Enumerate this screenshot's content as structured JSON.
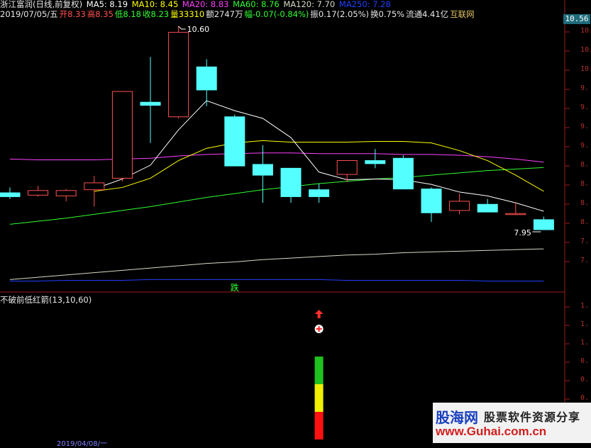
{
  "header": {
    "stock_name": "浙江富润(日线,前复权)",
    "ma5": "MA5: 8.19",
    "ma10": "MA10: 8.45",
    "ma20": "MA20: 8.83",
    "ma60": "MA60: 8.76",
    "ma120": "MA120: 7.70",
    "ma250": "MA250: 7.28",
    "date": "2019/07/05/五",
    "open_label": "开",
    "open_value": "8.33",
    "high_label": "高",
    "high_value": "8.35",
    "low_label": "低",
    "low_value": "8.18",
    "close_label": "收",
    "close_value": "8.23",
    "volume": "量33310",
    "amount": "额2747万",
    "change": "幅-0.07(-0.84%)",
    "amplitude": "振0.17(2.05%)",
    "turnover": "换0.75%",
    "float_cap": "流通4.41亿",
    "source": "互联网"
  },
  "price_tag": "10.56",
  "max_label": "10.60",
  "min_label": "7.95",
  "signal_text": "跌",
  "indicator": {
    "title": "不破前低红箭(13,10,60)"
  },
  "right_axis_price": [
    "10.",
    "10.",
    "10.",
    "9.",
    "9.",
    "9.",
    "9.",
    "8.",
    "8.",
    "8.",
    "8.",
    "7.",
    "7."
  ],
  "right_axis_indicator": [
    "1.",
    "1.",
    "1.",
    "0.",
    "0.",
    "0.",
    "0."
  ],
  "bottom_date": "2019/04/08/一",
  "colors": {
    "up": "#ff5050",
    "down": "#54ffff",
    "ma5": "#ffffff",
    "ma10": "#ffff00",
    "ma20": "#ff40ff",
    "ma60": "#30ff30",
    "ma120": "#d8d8c8",
    "ma250": "#2040ff"
  },
  "chart_data": {
    "type": "candlestick",
    "candles": [
      {
        "o": 8.43,
        "h": 8.5,
        "l": 8.35,
        "c": 8.38
      },
      {
        "o": 8.4,
        "h": 8.52,
        "l": 8.38,
        "c": 8.46
      },
      {
        "o": 8.39,
        "h": 8.48,
        "l": 8.32,
        "c": 8.46
      },
      {
        "o": 8.47,
        "h": 8.65,
        "l": 8.25,
        "c": 8.56
      },
      {
        "o": 8.62,
        "h": 9.75,
        "l": 8.58,
        "c": 9.75
      },
      {
        "o": 9.61,
        "h": 10.2,
        "l": 9.08,
        "c": 9.57
      },
      {
        "o": 9.42,
        "h": 10.6,
        "l": 9.4,
        "c": 10.52
      },
      {
        "o": 10.07,
        "h": 10.17,
        "l": 9.56,
        "c": 9.77
      },
      {
        "o": 9.42,
        "h": 9.45,
        "l": 8.78,
        "c": 8.78
      },
      {
        "o": 8.8,
        "h": 9.05,
        "l": 8.3,
        "c": 8.66
      },
      {
        "o": 8.75,
        "h": 8.75,
        "l": 8.3,
        "c": 8.38
      },
      {
        "o": 8.47,
        "h": 8.55,
        "l": 8.3,
        "c": 8.38
      },
      {
        "o": 8.67,
        "h": 8.85,
        "l": 8.57,
        "c": 8.85
      },
      {
        "o": 8.85,
        "h": 9.0,
        "l": 8.75,
        "c": 8.81
      },
      {
        "o": 8.88,
        "h": 8.92,
        "l": 8.48,
        "c": 8.48
      },
      {
        "o": 8.48,
        "h": 8.5,
        "l": 8.05,
        "c": 8.17
      },
      {
        "o": 8.2,
        "h": 8.42,
        "l": 8.15,
        "c": 8.32
      },
      {
        "o": 8.28,
        "h": 8.35,
        "l": 8.18,
        "c": 8.18
      },
      {
        "o": 8.15,
        "h": 8.3,
        "l": 8.14,
        "c": 8.16
      },
      {
        "o": 8.08,
        "h": 8.12,
        "l": 7.95,
        "c": 7.95
      }
    ],
    "ma5": [
      null,
      null,
      null,
      8.48,
      8.61,
      8.79,
      9.25,
      9.63,
      9.5,
      9.4,
      9.15,
      8.7,
      8.6,
      8.61,
      8.6,
      8.54,
      8.44,
      8.39,
      8.3,
      8.19
    ],
    "ma10": [
      null,
      null,
      null,
      8.45,
      8.5,
      8.62,
      8.85,
      9.01,
      9.08,
      9.11,
      9.09,
      9.09,
      9.09,
      9.1,
      9.1,
      9.08,
      8.98,
      8.85,
      8.66,
      8.45
    ],
    "ma20": [
      8.87,
      8.86,
      8.86,
      8.86,
      8.87,
      8.88,
      8.91,
      8.93,
      8.94,
      8.95,
      8.95,
      8.94,
      8.94,
      8.94,
      8.93,
      8.93,
      8.92,
      8.9,
      8.87,
      8.83
    ],
    "ma60": [
      8.02,
      8.06,
      8.1,
      8.15,
      8.2,
      8.25,
      8.31,
      8.37,
      8.42,
      8.47,
      8.51,
      8.55,
      8.58,
      8.61,
      8.63,
      8.66,
      8.69,
      8.72,
      8.74,
      8.76
    ],
    "ma120": [
      7.3,
      7.33,
      7.36,
      7.39,
      7.42,
      7.45,
      7.48,
      7.51,
      7.53,
      7.56,
      7.58,
      7.6,
      7.62,
      7.63,
      7.65,
      7.66,
      7.67,
      7.68,
      7.69,
      7.7
    ],
    "ma250": [
      7.28,
      7.28,
      7.29,
      7.29,
      7.29,
      7.3,
      7.3,
      7.3,
      7.3,
      7.3,
      7.3,
      7.3,
      7.29,
      7.29,
      7.29,
      7.29,
      7.29,
      7.28,
      7.28,
      7.28
    ],
    "signal_index": 8,
    "indicator_bar": {
      "index": 11,
      "segments": [
        "#20c020",
        "#f0f000",
        "#ff1010"
      ]
    },
    "indicator_markers": [
      "up-arrow",
      "plus-circle"
    ]
  }
}
